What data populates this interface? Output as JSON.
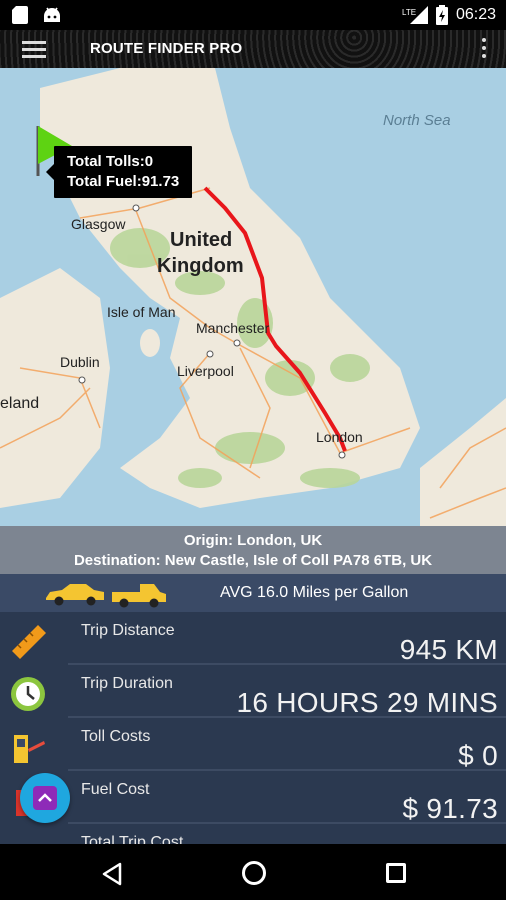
{
  "status_bar": {
    "time": "06:23",
    "network": "LTE",
    "icons": [
      "sd-card-icon",
      "android-icon",
      "lte-signal-icon",
      "battery-charging-icon"
    ]
  },
  "app_bar": {
    "title": "ROUTE FINDER PRO",
    "icons": [
      "hamburger-menu-icon",
      "overflow-menu-icon"
    ]
  },
  "map": {
    "labels": {
      "north_sea": "North Sea",
      "glasgow": "Glasgow",
      "united": "United",
      "kingdom": "Kingdom",
      "isle_of_man": "Isle of Man",
      "manchester": "Manchester",
      "liverpool": "Liverpool",
      "dublin": "Dublin",
      "ireland": "eland",
      "london": "London"
    },
    "tooltip": {
      "tolls": "Total Tolls:0",
      "fuel": "Total Fuel:91.73"
    },
    "colors": {
      "water": "#a9cfe3",
      "land": "#efe9dc",
      "route": "#e8161b",
      "flag": "#5ed312"
    }
  },
  "trip": {
    "origin": "Origin: London, UK",
    "destination": "Destination: New Castle, Isle of Coll PA78 6TB, UK",
    "avg": "AVG 16.0 Miles per Gallon"
  },
  "stats": [
    {
      "label": "Trip Distance",
      "value": "945 KM",
      "icon": "ruler-icon"
    },
    {
      "label": "Trip Duration",
      "value": "16 HOURS 29 MINS",
      "icon": "clock-icon"
    },
    {
      "label": "Toll Costs",
      "value": "$ 0",
      "icon": "toll-booth-icon"
    },
    {
      "label": "Fuel Cost",
      "value": "$ 91.73",
      "icon": "fuel-pump-icon"
    },
    {
      "label": "Total Trip Cost",
      "value": "",
      "icon": "receipt-icon"
    }
  ],
  "nav": {
    "icons": [
      "back-icon",
      "home-icon",
      "recents-icon"
    ]
  }
}
